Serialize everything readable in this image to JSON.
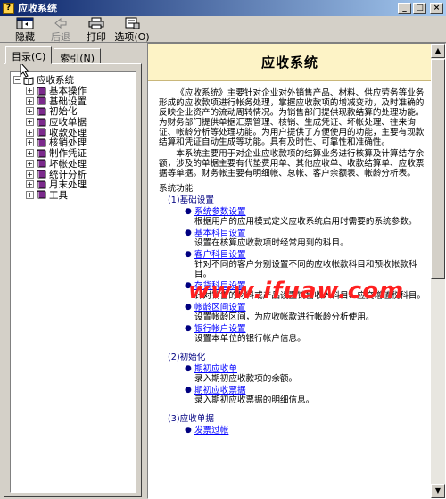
{
  "window": {
    "title": "应收系统",
    "min": "_",
    "max": "□",
    "close": "×"
  },
  "toolbar": {
    "buttons": [
      {
        "label": "隐藏",
        "icon": "hide-icon",
        "enabled": true
      },
      {
        "label": "后退",
        "icon": "back-arrow-icon",
        "enabled": false
      },
      {
        "label": "打印",
        "icon": "printer-icon",
        "enabled": true
      },
      {
        "label": "选项(O)",
        "icon": "options-icon",
        "enabled": true
      }
    ]
  },
  "tabs": {
    "contents": "目录(C)",
    "index": "索引(N)"
  },
  "tree": {
    "root": "应收系统",
    "items": [
      "基本操作",
      "基础设置",
      "初始化",
      "应收单据",
      "收款处理",
      "核销处理",
      "制作凭证",
      "坏帐处理",
      "统计分析",
      "月末处理",
      "工具"
    ]
  },
  "content": {
    "title": "应收系统",
    "intro1": "《应收系统》主要针对企业对外销售产品、材料、供应劳务等业务形成的应收款项进行帐务处理，掌握应收款项的增减变动，及时准确的反映企业资产的流动周转情况。为销售部门提供现款结算的处理功能。为财务部门提供单据汇票管理、核销、生成凭证、坏帐处理、往来询证、帐龄分析等处理功能。为用户提供了方便使用的功能，主要有现款结算和凭证自动生成等功能。具有及时性、可靠性和准确性。",
    "intro2": "本系统主要用于对企业应收款项的结算业务进行核算及计算结存余额，涉及的单据主要有代垫费用单、其他应收单、收款结算单、应收票据等单据。财务帐主要有明细帐、总帐、客户余额表、帐龄分析表。",
    "functions_label": "系统功能",
    "sections": [
      {
        "title": "(1)基础设置",
        "items": [
          {
            "link": "系统参数设置",
            "desc": "根据用户的应用模式定义应收系统启用时需要的系统参数。"
          },
          {
            "link": "基本科目设置",
            "desc": "设置在核算应收款项时经常用到的科目。"
          },
          {
            "link": "客户科目设置",
            "desc": "针对不同的客户分别设置不同的应收帐款科目和预收帐款科目。"
          },
          {
            "link": "存货科目设置",
            "desc": "针对销售的材料或产品设置销售收入科目、应交增值税科目。"
          },
          {
            "link": "帐龄区间设置",
            "desc": "设置帐龄区间，为应收帐款进行帐龄分析使用。"
          },
          {
            "link": "银行帐户设置",
            "desc": "设置本单位的银行帐户信息。"
          }
        ]
      },
      {
        "title": "(2)初始化",
        "items": [
          {
            "link": "期初应收单",
            "desc": "录入期初应收款项的余额。"
          },
          {
            "link": "期初应收票据",
            "desc": "录入期初应收票据的明细信息。"
          }
        ]
      },
      {
        "title": "(3)应收单据",
        "items": [
          {
            "link": "发票过帐",
            "desc": ""
          }
        ]
      }
    ],
    "watermark": "www.ifuaw.com"
  },
  "colors": {
    "titlebar_start": "#0a246a",
    "titlebar_end": "#a6caf0",
    "header_band": "#fdf3c6",
    "link": "#0000ff",
    "watermark": "#ff2020",
    "book": "#7b2a8c"
  }
}
